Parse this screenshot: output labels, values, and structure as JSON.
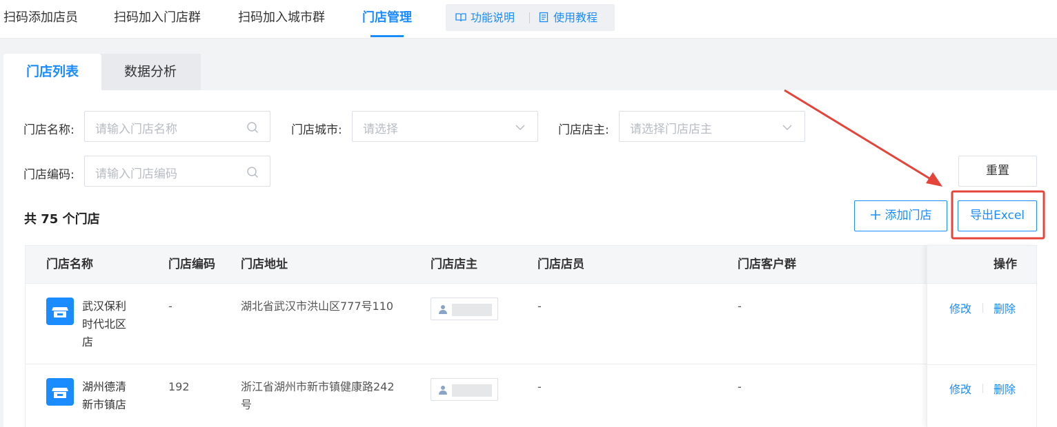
{
  "topnav": {
    "tabs": [
      {
        "label": "扫码添加店员"
      },
      {
        "label": "扫码加入门店群"
      },
      {
        "label": "扫码加入城市群"
      },
      {
        "label": "门店管理"
      }
    ],
    "help": {
      "feature_label": "功能说明",
      "tutorial_label": "使用教程"
    }
  },
  "panel": {
    "tabs": [
      {
        "label": "门店列表"
      },
      {
        "label": "数据分析"
      }
    ],
    "filters": {
      "store_name_label": "门店名称:",
      "store_name_placeholder": "请输入门店名称",
      "city_label": "门店城市:",
      "city_placeholder": "请选择",
      "owner_label": "门店店主:",
      "owner_placeholder": "请选择门店店主",
      "code_label": "门店编码:",
      "code_placeholder": "请输入门店编码"
    },
    "reset_label": "重置",
    "count_text": "共 75 个门店",
    "add_store_label": "添加门店",
    "export_label": "导出Excel"
  },
  "table": {
    "headers": {
      "name": "门店名称",
      "code": "门店编码",
      "address": "门店地址",
      "owner": "门店店主",
      "staff": "门店店员",
      "groups": "门店客户群",
      "action": "操作"
    },
    "rows": [
      {
        "name_lines": [
          "武汉保利",
          "时代北区",
          "店"
        ],
        "code": "-",
        "address_lines": [
          "湖北省武汉市洪山区777号110"
        ],
        "staff": "-",
        "groups": "-",
        "edit": "修改",
        "delete": "删除"
      },
      {
        "name_lines": [
          "湖州德清",
          "新市镇店"
        ],
        "code": "192",
        "address_lines": [
          "浙江省湖州市新市镇健康路242",
          "号"
        ],
        "staff": "-",
        "groups": "-",
        "edit": "修改",
        "delete": "删除"
      }
    ]
  },
  "colors": {
    "primary": "#1a8cff",
    "annotation": "#e5443a"
  }
}
